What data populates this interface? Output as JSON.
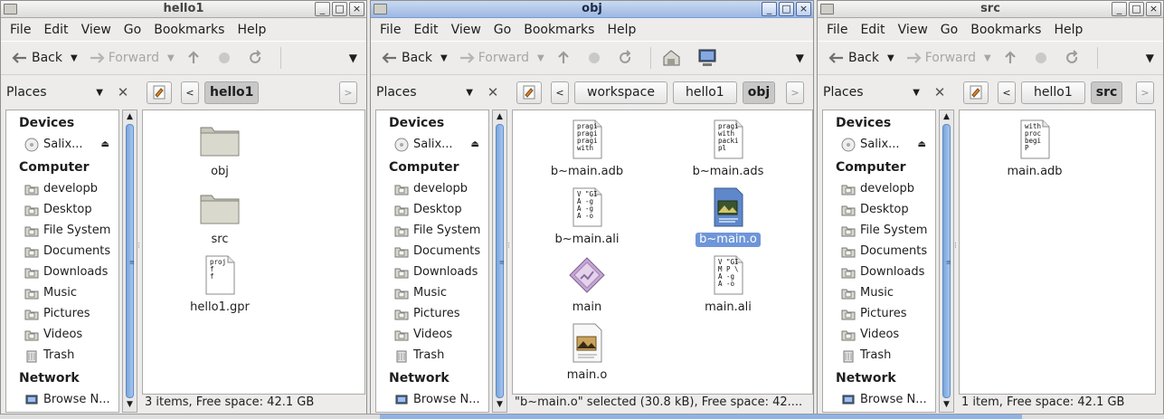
{
  "windows": [
    {
      "name": "left-window",
      "title": "hello1",
      "active": false,
      "menus": [
        "File",
        "Edit",
        "View",
        "Go",
        "Bookmarks",
        "Help"
      ],
      "toolbar": {
        "back": "Back",
        "forward": "Forward"
      },
      "places": "Places",
      "breadcrumbs": [
        "hello1"
      ],
      "sidebar": {
        "devices_heading": "Devices",
        "device": "Salix...",
        "computer_heading": "Computer",
        "items": [
          "developb",
          "Desktop",
          "File System",
          "Documents",
          "Downloads",
          "Music",
          "Pictures",
          "Videos",
          "Trash"
        ],
        "network_heading": "Network",
        "network_item": "Browse N..."
      },
      "files": [
        {
          "name": "obj",
          "type": "folder"
        },
        {
          "name": "src",
          "type": "folder"
        },
        {
          "name": "hello1.gpr",
          "type": "gpr"
        }
      ],
      "status": "3 items, Free space: 42.1 GB"
    },
    {
      "name": "middle-window",
      "title": "obj",
      "active": true,
      "menus": [
        "File",
        "Edit",
        "View",
        "Go",
        "Bookmarks",
        "Help"
      ],
      "toolbar": {
        "back": "Back",
        "forward": "Forward"
      },
      "places": "Places",
      "breadcrumbs": [
        "workspace",
        "hello1",
        "obj"
      ],
      "sidebar": {
        "devices_heading": "Devices",
        "device": "Salix...",
        "computer_heading": "Computer",
        "items": [
          "developb",
          "Desktop",
          "File System",
          "Documents",
          "Downloads",
          "Music",
          "Pictures",
          "Videos",
          "Trash"
        ],
        "network_heading": "Network",
        "network_item": "Browse N..."
      },
      "files": [
        {
          "name": "b~main.adb",
          "type": "text-adb"
        },
        {
          "name": "b~main.ads",
          "type": "text-ads"
        },
        {
          "name": "b~main.ali",
          "type": "text-ali"
        },
        {
          "name": "b~main.o",
          "type": "object-selected",
          "selected": true
        },
        {
          "name": "main",
          "type": "executable"
        },
        {
          "name": "main.ali",
          "type": "text-ali2"
        },
        {
          "name": "main.o",
          "type": "object"
        }
      ],
      "status": "\"b~main.o\" selected (30.8 kB), Free space: 42...."
    },
    {
      "name": "right-window",
      "title": "src",
      "active": false,
      "menus": [
        "File",
        "Edit",
        "View",
        "Go",
        "Bookmarks",
        "Help"
      ],
      "toolbar": {
        "back": "Back",
        "forward": "Forward"
      },
      "places": "Places",
      "breadcrumbs": [
        "hello1",
        "src"
      ],
      "sidebar": {
        "devices_heading": "Devices",
        "device": "Salix...",
        "computer_heading": "Computer",
        "items": [
          "developb",
          "Desktop",
          "File System",
          "Documents",
          "Downloads",
          "Music",
          "Pictures",
          "Videos",
          "Trash"
        ],
        "network_heading": "Network",
        "network_item": "Browse N..."
      },
      "files": [
        {
          "name": "main.adb",
          "type": "text-main"
        }
      ],
      "status": "1 item, Free space: 42.1 GB"
    }
  ],
  "file_snippets": {
    "gpr": [
      "proj",
      "f",
      "f"
    ],
    "text-adb": [
      "pragi",
      "pragi",
      "pragi",
      "with"
    ],
    "text-ads": [
      "pragi",
      "with",
      "packi",
      "pl"
    ],
    "text-ali": [
      "V \"GI",
      "A -g",
      "A -g",
      "A -o"
    ],
    "text-ali2": [
      "V \"GI",
      "M P \\",
      "A -g",
      "A -o"
    ],
    "text-main": [
      "with",
      "proc",
      "begi",
      "P"
    ]
  },
  "colors": {
    "selection": "#6f96d8",
    "scroll_thumb": "#8fb3e7",
    "active_title": "#9cb8e3"
  }
}
